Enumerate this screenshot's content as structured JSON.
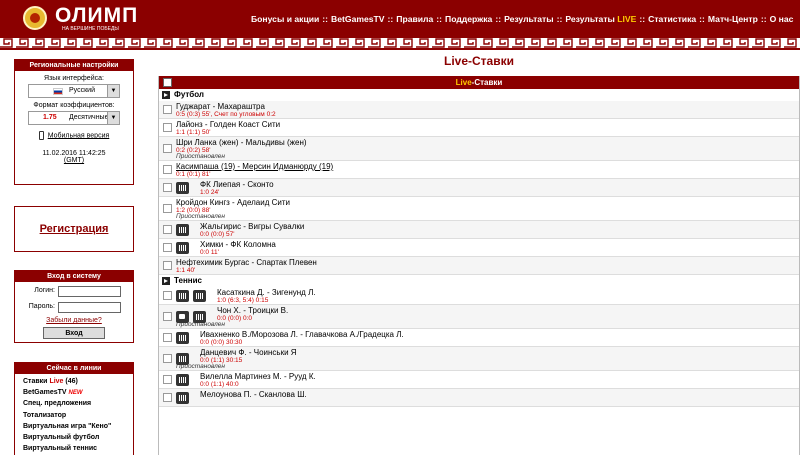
{
  "header": {
    "logo": "ОЛИМП",
    "tagline": "НА ВЕРШИНЕ ПОБЕДЫ",
    "nav": [
      {
        "label": "Бонусы и акции"
      },
      {
        "label": "BetGamesTV"
      },
      {
        "label": "Правила"
      },
      {
        "label": "Поддержка"
      },
      {
        "label": "Результаты"
      },
      {
        "label": "Результаты",
        "live": "LIVE"
      },
      {
        "label": "Статистика"
      },
      {
        "label": "Матч-Центр"
      },
      {
        "label": "О нас"
      }
    ],
    "separator": "::"
  },
  "sidebar": {
    "settings": {
      "title": "Региональные настройки",
      "language_label": "Язык интерфейса:",
      "language_value": "Русский",
      "odds_label": "Формат коэффициентов:",
      "odds_number": "1.75",
      "odds_value": "Десятичные",
      "mobile": "Мобильная версия",
      "datetime": "11.02.2016 11:42:25",
      "gmt": "(GMT)"
    },
    "registration": "Регистрация",
    "login": {
      "title": "Вход в систему",
      "login_label": "Логин:",
      "password_label": "Пароль:",
      "forgot": "Забыли данные?",
      "button": "Вход"
    },
    "now": {
      "title": "Сейчас в линии",
      "items": [
        {
          "label": "Ставки ",
          "live": "Live",
          "count": " (46)"
        },
        {
          "label": "BetGamesTV ",
          "badge": "NEW"
        },
        {
          "label": "Спец. предложения"
        },
        {
          "label": "Тотализатор"
        },
        {
          "label": "Виртуальная игра \"Кено\""
        },
        {
          "label": "Виртуальный футбол"
        },
        {
          "label": "Виртуальный теннис"
        }
      ]
    }
  },
  "main": {
    "title": "Live-Ставки",
    "table_header_live": "Live",
    "table_header_rest": "-Ставки",
    "sports": [
      {
        "name": "Футбол",
        "events": [
          {
            "name": "Гуджарат - Махараштра",
            "score": "0:5 (0:3) 55', Счет по угловым 0:2",
            "suspended": "",
            "icons": []
          },
          {
            "name": "Лайонз - Голден Коаст Сити",
            "score": "1:1 (1:1) 50'",
            "suspended": "",
            "icons": []
          },
          {
            "name": "Шри Ланка (жен) - Мальдивы (жен)",
            "score": "0:2 (0:2) 58'",
            "suspended": "Приостановлен",
            "icons": []
          },
          {
            "name": "Касимпаша (19) - Мерсин Идманюрду (19)",
            "score": "0:1 (0:1) 81'",
            "suspended": "",
            "icons": [],
            "underline": true
          },
          {
            "name": "ФК Лиепая - Сконто",
            "score": "1:0 24'",
            "suspended": "",
            "icons": [
              "stats"
            ]
          },
          {
            "name": "Кройдон Кингз - Аделаид Сити",
            "score": "1:2 (0:0) 88'",
            "suspended": "Приостановлен",
            "icons": []
          },
          {
            "name": "Жальгирис - Вигры Сувалки",
            "score": "0:0 (0:0) 57'",
            "suspended": "",
            "icons": [
              "stats"
            ]
          },
          {
            "name": "Химки - ФК Коломна",
            "score": "0:0 11'",
            "suspended": "",
            "icons": [
              "stats"
            ]
          },
          {
            "name": "Нефтехимик Бургас - Спартак Плевен",
            "score": "1:1 40'",
            "suspended": "",
            "icons": []
          }
        ]
      },
      {
        "name": "Теннис",
        "events": [
          {
            "name": "Касаткина Д. - Зигенунд Л.",
            "score": "1:0 (6:3, 5:4) 0:15",
            "suspended": "",
            "icons": [
              "stats",
              "stats"
            ]
          },
          {
            "name": "Чон Х. - Троицки В.",
            "score": "0:0 (0:0) 0:0",
            "suspended": "Приостановлен",
            "icons": [
              "video",
              "stats"
            ]
          },
          {
            "name": "Ивахненко В./Морозова Л. - Главачкова А./Градецка Л.",
            "score": "0:0 (0:0) 30:30",
            "suspended": "",
            "icons": [
              "stats"
            ]
          },
          {
            "name": "Данцевич Ф. - Чоинськи Я",
            "score": "0:0 (1:1) 30:15",
            "suspended": "Приостановлен",
            "icons": [
              "stats"
            ]
          },
          {
            "name": "Вилелла Мартинез М. - Рууд К.",
            "score": "0:0 (1:1) 40:0",
            "suspended": "",
            "icons": [
              "stats"
            ]
          },
          {
            "name": "Мелоунова П. - Сканлова Ш.",
            "score": "",
            "suspended": "",
            "icons": [
              "stats"
            ]
          }
        ]
      }
    ]
  },
  "colors": {
    "brand": "#8b0000",
    "live": "#ffcc00",
    "score": "#cc0000"
  }
}
